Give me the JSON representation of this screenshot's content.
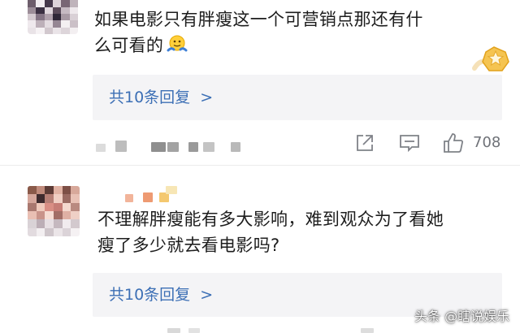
{
  "comments": [
    {
      "text_line1": "如果电影只有胖瘦这一个可营销点那还有什",
      "text_line2": "么可看的",
      "emoji": "shrug-emoji",
      "badge": "gold-star-badge",
      "reply_label": "共10条回复",
      "reply_chevron": ">",
      "like_count": "708"
    },
    {
      "text_line1": "不理解胖瘦能有多大影响，难到观众为了看她",
      "text_line2": "瘦了多少就去看电影吗?",
      "reply_label": "共10条回复",
      "reply_chevron": ">"
    }
  ],
  "icons": [
    "share-icon",
    "comment-icon",
    "like-icon"
  ],
  "watermark": "头条 @瞎说娱乐",
  "colors": {
    "reply_link": "#3c6fb5",
    "reply_bg": "#f4f4f6",
    "action_grey": "#7f8288"
  }
}
